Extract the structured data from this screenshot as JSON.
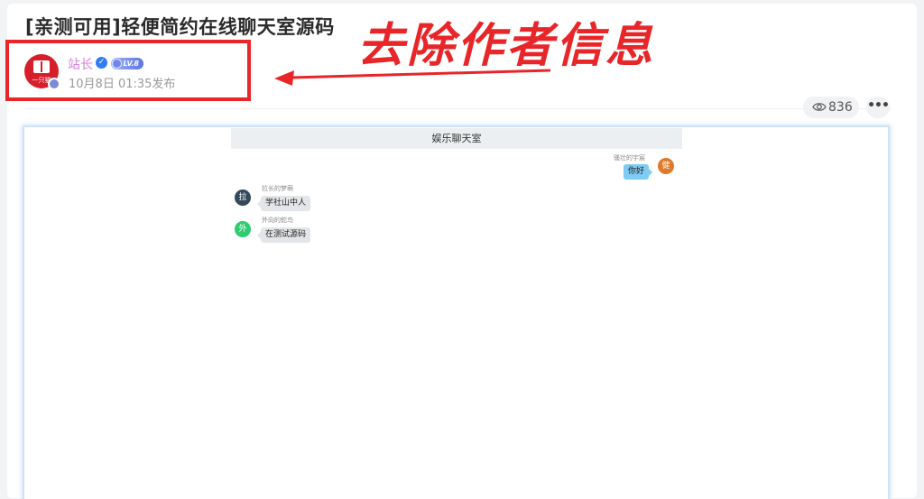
{
  "post": {
    "title": "[亲测可用]轻便简约在线聊天室源码",
    "author_name": "站长",
    "level_badge": "LV.8",
    "publish_time": "10月8日 01:35发布",
    "avatar_text": "一只猫",
    "views": "836",
    "more_label": "•••"
  },
  "annotation": {
    "text": "去除作者信息",
    "color": "#e8262a"
  },
  "chat": {
    "room_title": "娱乐聊天室",
    "messages": [
      {
        "side": "right",
        "sender": "骚壮的宇宸",
        "avatar_char": "健",
        "avatar_color": "#e07a2a",
        "text": "你好"
      },
      {
        "side": "left",
        "sender": "拉长的梦萌",
        "avatar_char": "拉",
        "avatar_color": "#34495e",
        "text": "学社山中人"
      },
      {
        "side": "left",
        "sender": "外向的蛇鸟",
        "avatar_char": "外",
        "avatar_color": "#2ecc71",
        "text": "在测试源码"
      }
    ]
  },
  "icons": {
    "eye": "eye-icon",
    "verified": "verified-icon",
    "more": "more-icon"
  }
}
